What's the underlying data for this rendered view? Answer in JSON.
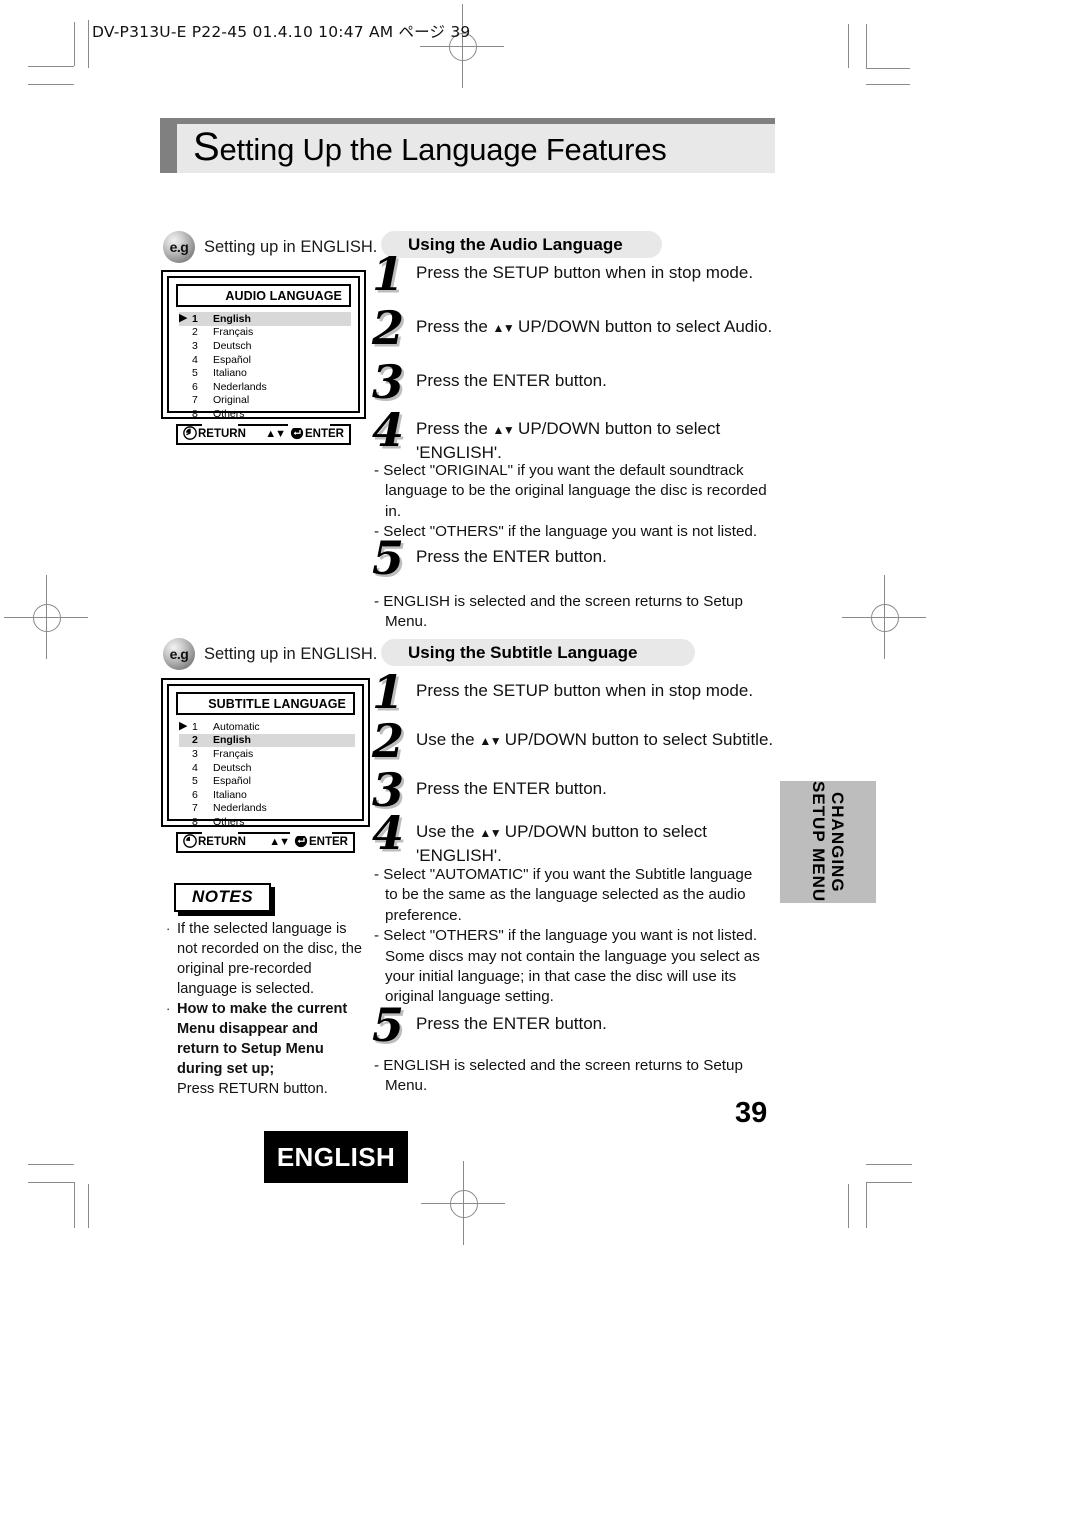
{
  "print_header": "DV-P313U-E P22-45  01.4.10 10:47 AM  ページ 39",
  "chapter_title": {
    "initial": "S",
    "rest": "etting Up the Language Features"
  },
  "audio_example": {
    "badge": "e.g",
    "caption": "Setting up in ENGLISH.",
    "osd": {
      "title": "AUDIO LANGUAGE",
      "items": [
        {
          "num": "1",
          "label": "English",
          "arrow": true,
          "selected": true
        },
        {
          "num": "2",
          "label": "Français",
          "arrow": false,
          "selected": false
        },
        {
          "num": "3",
          "label": "Deutsch",
          "arrow": false,
          "selected": false
        },
        {
          "num": "4",
          "label": "Español",
          "arrow": false,
          "selected": false
        },
        {
          "num": "5",
          "label": "Italiano",
          "arrow": false,
          "selected": false
        },
        {
          "num": "6",
          "label": "Nederlands",
          "arrow": false,
          "selected": false
        },
        {
          "num": "7",
          "label": "Original",
          "arrow": false,
          "selected": false
        },
        {
          "num": "8",
          "label": "Others",
          "arrow": false,
          "selected": false
        }
      ],
      "return_label": "RETURN",
      "enter_label": "ENTER",
      "updown_glyph": "▲▼"
    }
  },
  "subtitle_example": {
    "badge": "e.g",
    "caption": "Setting up in ENGLISH.",
    "osd": {
      "title": "SUBTITLE LANGUAGE",
      "items": [
        {
          "num": "1",
          "label": "Automatic",
          "arrow": true,
          "selected": false
        },
        {
          "num": "2",
          "label": "English",
          "arrow": false,
          "selected": true
        },
        {
          "num": "3",
          "label": "Français",
          "arrow": false,
          "selected": false
        },
        {
          "num": "4",
          "label": "Deutsch",
          "arrow": false,
          "selected": false
        },
        {
          "num": "5",
          "label": "Español",
          "arrow": false,
          "selected": false
        },
        {
          "num": "6",
          "label": "Italiano",
          "arrow": false,
          "selected": false
        },
        {
          "num": "7",
          "label": "Nederlands",
          "arrow": false,
          "selected": false
        },
        {
          "num": "8",
          "label": "Others",
          "arrow": false,
          "selected": false
        }
      ],
      "return_label": "RETURN",
      "enter_label": "ENTER",
      "updown_glyph": "▲▼"
    }
  },
  "audio_section": {
    "heading": "Using the Audio Language",
    "steps": [
      {
        "num": "1",
        "text_before": "Press the SETUP button when in stop mode.",
        "glyph": "",
        "text_after": ""
      },
      {
        "num": "2",
        "text_before": "Press the ",
        "glyph": "▲▼",
        "text_after": " UP/DOWN button to select Audio."
      },
      {
        "num": "3",
        "text_before": "Press the ENTER button.",
        "glyph": "",
        "text_after": ""
      },
      {
        "num": "4",
        "text_before": "Press the ",
        "glyph": "▲▼",
        "text_after": " UP/DOWN button to select 'ENGLISH'."
      },
      {
        "num": "5",
        "text_before": "Press the ENTER button.",
        "glyph": "",
        "text_after": ""
      }
    ],
    "notes_after_step4": [
      "- Select \"ORIGINAL\" if you want the default soundtrack language to be the original language the disc is recorded in.",
      "- Select \"OTHERS\" if the language you want is not listed."
    ],
    "notes_after_step5": [
      "- ENGLISH is selected and the screen returns to Setup Menu."
    ]
  },
  "subtitle_section": {
    "heading": "Using the Subtitle Language",
    "steps": [
      {
        "num": "1",
        "text_before": "Press the SETUP button when in stop mode.",
        "glyph": "",
        "text_after": ""
      },
      {
        "num": "2",
        "text_before": "Use the ",
        "glyph": "▲▼",
        "text_after": " UP/DOWN button to select Subtitle."
      },
      {
        "num": "3",
        "text_before": "Press the ENTER button.",
        "glyph": "",
        "text_after": ""
      },
      {
        "num": "4",
        "text_before": "Use the ",
        "glyph": "▲▼",
        "text_after": " UP/DOWN button to select 'ENGLISH'."
      },
      {
        "num": "5",
        "text_before": "Press the ENTER button.",
        "glyph": "",
        "text_after": ""
      }
    ],
    "notes_after_step4": [
      "- Select \"AUTOMATIC\" if you want the Subtitle language to be the same as the language selected as the audio preference.",
      "- Select \"OTHERS\" if the language you want is not listed. Some discs may not contain the language you select as your initial language; in that case the disc will use its original   language setting."
    ],
    "notes_after_step5": [
      "- ENGLISH is selected and the screen returns to Setup Menu."
    ]
  },
  "notes_box": {
    "header": "NOTES",
    "items": [
      {
        "bullet": "·",
        "text": "If the selected language is not recorded on the disc, the original pre-recorded language is selected.",
        "bold": false
      },
      {
        "bullet": "·",
        "text": "How to make the current Menu disappear and return to Setup Menu during set up;",
        "bold": true
      }
    ],
    "tail": "Press RETURN button."
  },
  "side_tab": {
    "line1": "CHANGING",
    "line2": "SETUP MENU",
    "background": "#bdbdbd"
  },
  "footer": {
    "page_number": "39",
    "language_badge": "ENGLISH"
  }
}
